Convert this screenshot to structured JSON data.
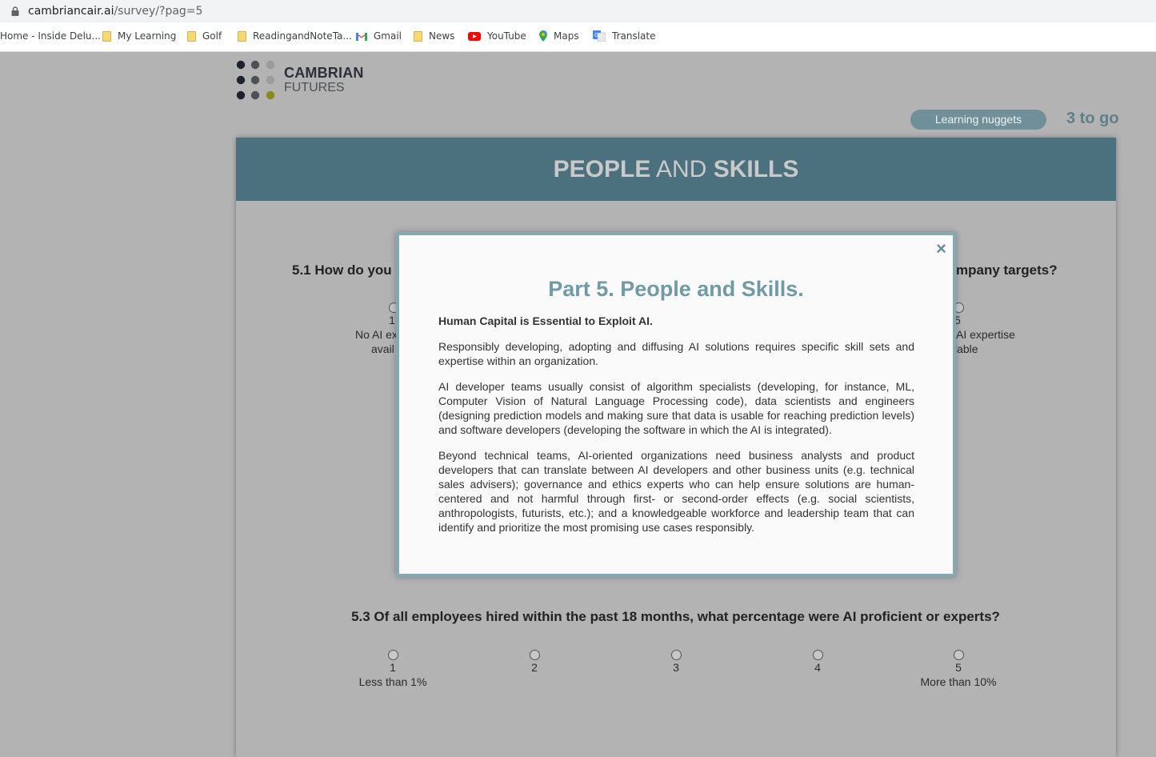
{
  "browser": {
    "url_host": "cambriancair.ai",
    "url_path": "/survey/?pag=5",
    "bookmarks": [
      {
        "label": "Home - Inside Delu...",
        "icon": "none"
      },
      {
        "label": "My Learning",
        "icon": "folder-icon"
      },
      {
        "label": "Golf",
        "icon": "folder-icon"
      },
      {
        "label": "ReadingandNoteTa...",
        "icon": "folder-icon"
      },
      {
        "label": "Gmail",
        "icon": "gmail-icon"
      },
      {
        "label": "News",
        "icon": "folder-icon"
      },
      {
        "label": "YouTube",
        "icon": "youtube-icon"
      },
      {
        "label": "Maps",
        "icon": "maps-icon"
      },
      {
        "label": "Translate",
        "icon": "translate-icon"
      }
    ]
  },
  "logo": {
    "line1": "CAMBRIAN",
    "line2": "FUTURES"
  },
  "header": {
    "nuggets_label": "Learning nuggets",
    "remaining": "3 to go"
  },
  "section": {
    "title_word1": "PEOPLE",
    "title_word2": "AND",
    "title_word3": "SKILLS"
  },
  "questions": [
    {
      "prefix": "5.1 How do you",
      "suffix": "mpany targets?",
      "options": [
        {
          "num": "1",
          "label1": "No AI ex",
          "label2": "avail"
        },
        {
          "num": "5",
          "label1": "AI expertise",
          "label2": "lable"
        }
      ]
    },
    {
      "text": "5.3 Of all employees hired within the past 18 months, what percentage were AI proficient or experts?",
      "options": [
        {
          "num": "1",
          "label": "Less than 1%"
        },
        {
          "num": "2",
          "label": ""
        },
        {
          "num": "3",
          "label": ""
        },
        {
          "num": "4",
          "label": ""
        },
        {
          "num": "5",
          "label": "More than 10%"
        }
      ]
    }
  ],
  "modal": {
    "close_symbol": "×",
    "title": "Part 5. People and Skills.",
    "lead": "Human Capital is Essential to Exploit AI.",
    "paragraphs": [
      "Responsibly developing, adopting and diffusing AI solutions requires specific skill sets and expertise within an organization.",
      "AI developer teams usually consist of algorithm specialists (developing, for instance, ML, Computer Vision of Natural Language Processing code), data scientists and engineers (designing prediction models and making sure that data is usable for reaching prediction levels) and software developers (developing the software in which the AI is integrated).",
      "Beyond technical teams, AI-oriented organizations need business analysts and product developers that can translate between AI developers and other business units (e.g. technical sales advisers); governance and ethics experts who can help ensure solutions are human-centered and not harmful through first- or second-order effects (e.g. social scientists, anthropologists, futurists, etc.); and a knowledgeable workforce and leadership team that can identify and prioritize the most promising use cases responsibly."
    ]
  },
  "colors": {
    "header_bg": "#4b717e",
    "accent": "#6f9aa6",
    "overlay_bg": "#b3b3b3",
    "button_bg": "#6f8f99"
  }
}
